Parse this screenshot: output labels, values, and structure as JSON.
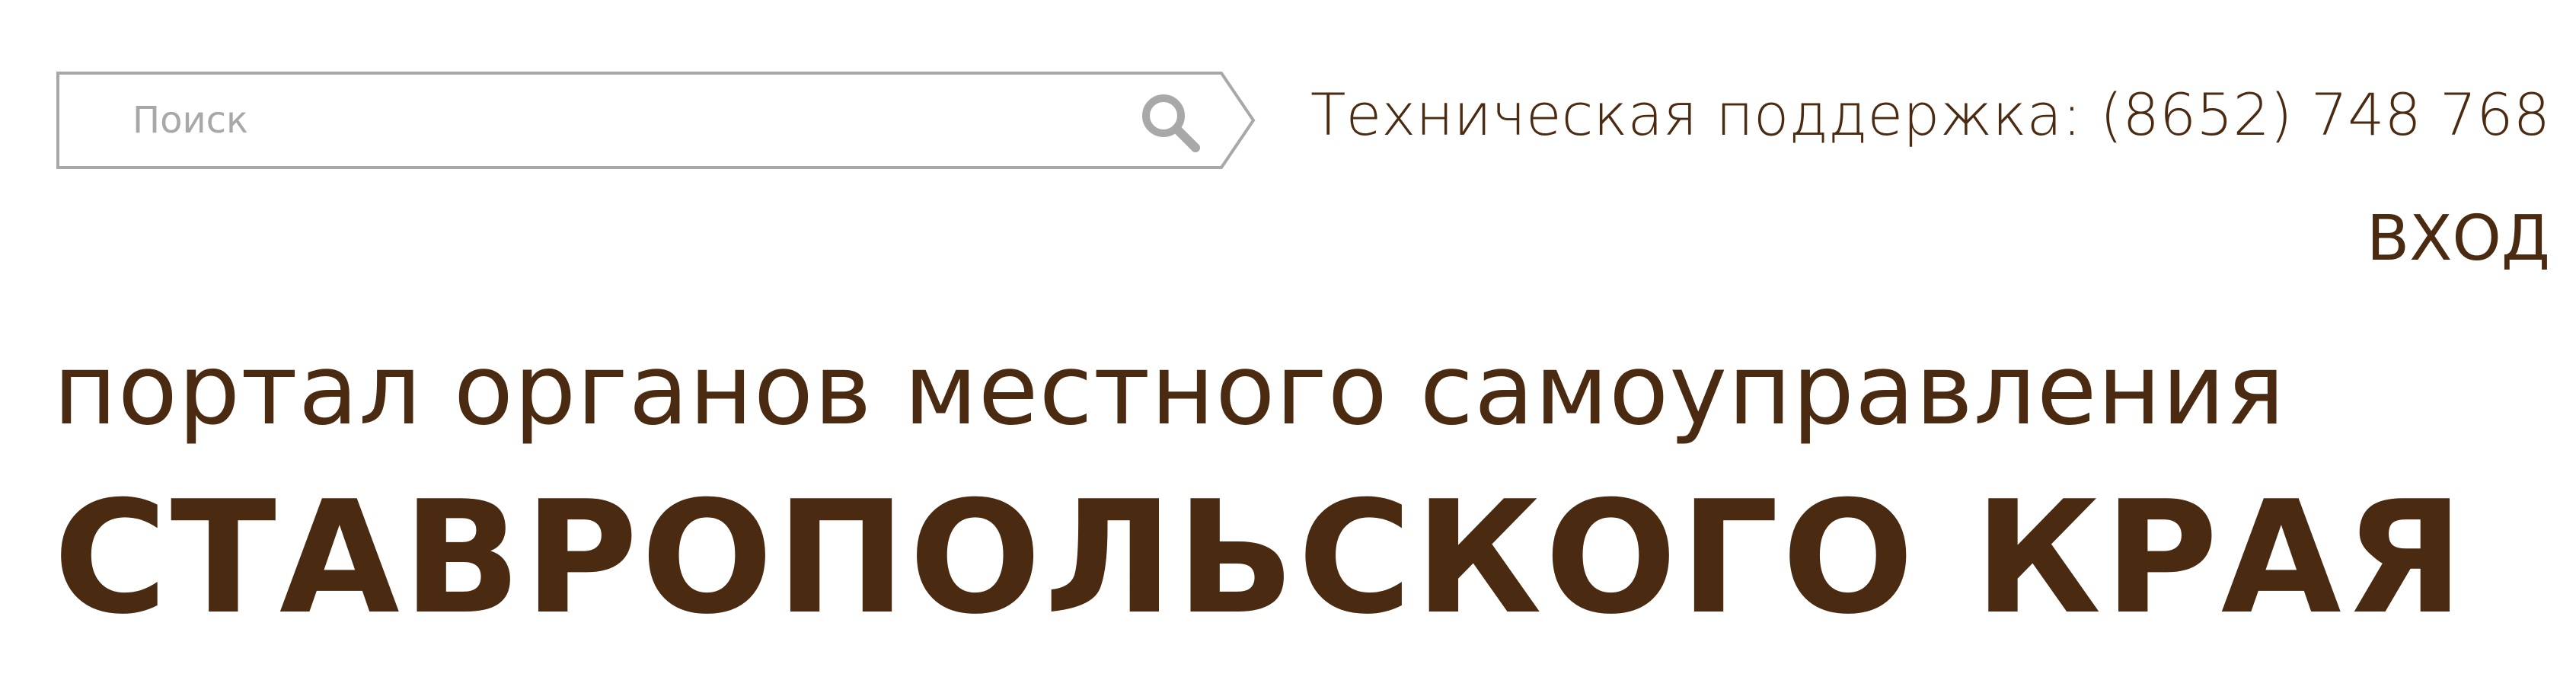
{
  "search": {
    "placeholder": "Поиск",
    "value": ""
  },
  "header": {
    "support_text": "Техническая поддержка: (8652) 748 768",
    "login_label": "ВХОД"
  },
  "portal": {
    "title_line1": "портал органов местного самоуправления",
    "title_line2": "СТАВРОПОЛЬСКОГО КРАЯ"
  },
  "colors": {
    "text": "#4a2a10",
    "search_border": "#a8a8a8",
    "placeholder": "#a8a8a8",
    "background": "#ffffff"
  }
}
